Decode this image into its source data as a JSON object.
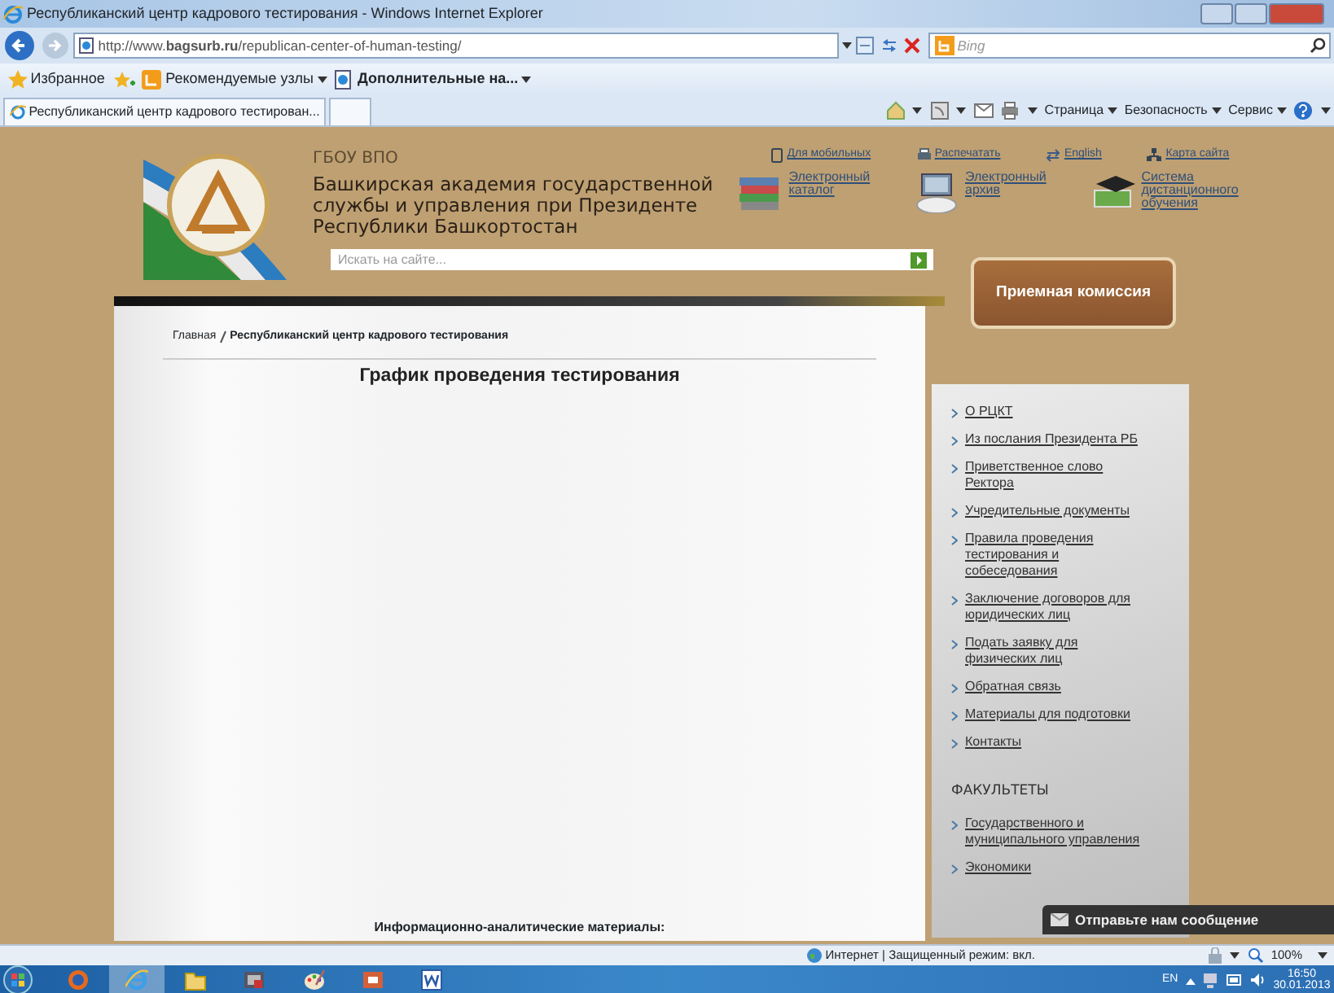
{
  "window": {
    "title": "Республиканский центр кадрового тестирования - Windows Internet Explorer"
  },
  "address_bar": {
    "url": "http://www.**bagsurb.ru**/republican-center-of-human-testing/",
    "search_placeholder": "Bing"
  },
  "favorites_bar": [
    {
      "kind": "favorites",
      "label": "Избранное",
      "dropdown": false
    },
    {
      "kind": "suggested",
      "label": "Рекомендуемые узлы",
      "dropdown": true
    },
    {
      "kind": "page",
      "label": "Дополнительные на...",
      "dropdown": true
    }
  ],
  "tabs": [
    {
      "label": "Республиканский центр кадрового тестирован...",
      "selected": true
    }
  ],
  "command_bar": [
    "Страница",
    "Безопасность",
    "Сервис"
  ],
  "header": {
    "org_type": "ГБОУ ВПО",
    "name": "Башкирская академия государственной службы и управления при Президенте Республики Башкортостан",
    "top_links": [
      {
        "kind": "mobile",
        "label": "Для мобильных"
      },
      {
        "kind": "print",
        "label": "Распечатать"
      },
      {
        "kind": "language",
        "label": "English"
      },
      {
        "kind": "sitemap",
        "label": "Карта сайта"
      }
    ],
    "resource_links": [
      {
        "kind": "books",
        "label": "Электронный каталог"
      },
      {
        "kind": "archive",
        "label": "Электронный архив"
      },
      {
        "kind": "education",
        "label": "Система дистанционного обучения"
      }
    ],
    "search_placeholder": "Искать на сайте...",
    "admission_button": "Приемная комиссия"
  },
  "breadcrumb": {
    "links": [
      "Главная"
    ],
    "current": "Республиканский центр кадрового тестирования"
  },
  "content": {
    "heading": "График проведения тестирования",
    "footer_text": "Информационно-аналитические материалы:"
  },
  "sidebar": {
    "items": [
      "О РЦКТ",
      "Из послания Президента РБ",
      "Приветственное слово Ректора",
      "Учредительные документы",
      "Правила проведения тестирования и собеседования",
      "Заключение договоров для юридических лиц",
      "Подать заявку для физических лиц",
      "Обратная связь",
      "Материалы для подготовки",
      "Контакты"
    ],
    "section_title": "ФАКУЛЬТЕТЫ",
    "faculties": [
      "Государственного и муниципального управления",
      "Экономики"
    ]
  },
  "feedback_widget": {
    "label": "Отправьте нам сообщение"
  },
  "status_bar": {
    "zone": "Интернет | Защищенный режим: вкл.",
    "zoom": "100%"
  },
  "taskbar": {
    "apps": [
      {
        "kind": "firefox",
        "selected": false
      },
      {
        "kind": "ie",
        "selected": true
      },
      {
        "kind": "folder",
        "selected": false
      },
      {
        "kind": "video",
        "selected": false
      },
      {
        "kind": "paint",
        "selected": false
      },
      {
        "kind": "slides",
        "selected": false
      },
      {
        "kind": "word",
        "selected": false
      }
    ],
    "language": "EN",
    "time": "16:50",
    "date": "30.01.2013"
  }
}
